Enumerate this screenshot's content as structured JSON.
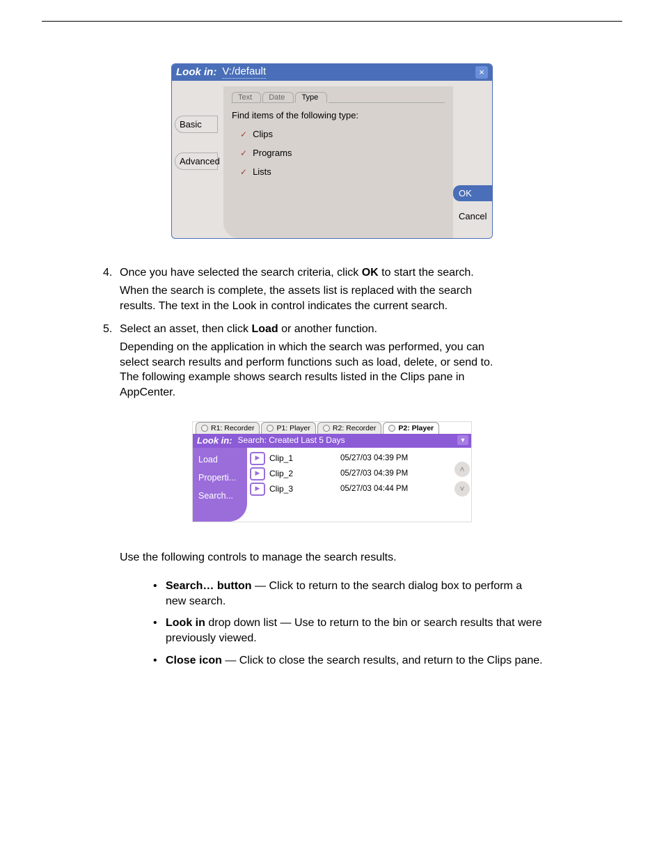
{
  "dialog1": {
    "lookin_label": "Look in:",
    "lookin_path": "V:/default",
    "left_tabs": [
      "Basic",
      "Advanced"
    ],
    "sub_tabs": [
      "Text",
      "Date",
      "Type"
    ],
    "find_label": "Find items of the following type:",
    "checks": [
      "Clips",
      "Programs",
      "Lists"
    ],
    "ok": "OK",
    "cancel": "Cancel"
  },
  "steps": {
    "s4_num": "4.",
    "s4_text": "Once you have selected the search criteria, click ",
    "s4_btn": "OK",
    "s4_tail": " to start the search.",
    "s4_sub": "When the search is complete, the assets list is replaced with the search results. The text in the Look in control indicates the current search.",
    "s5_num": "5.",
    "s5_text": "Select an asset, then click ",
    "s5_btn": "Load",
    "s5_tail": " or another function.",
    "s5_sub": "Depending on the application in which the search was performed, you can select search results and perform functions such as load, delete, or send to. The following example shows search results listed in the Clips pane in AppCenter.",
    "use_label": "Use the following controls to manage the search results.",
    "bullets": [
      {
        "bold": "Search… button",
        "text": " — Click to return to the search dialog box to perform a new search."
      },
      {
        "bold": "Look in",
        "text": " drop down list — Use to return to the bin or search results that were previously viewed."
      },
      {
        "bold": "Close icon ",
        "text": "— Click to close the search results, and return to the Clips pane."
      }
    ]
  },
  "dialog2": {
    "tabs": [
      "R1: Recorder",
      "P1: Player",
      "R2: Recorder",
      "P2: Player"
    ],
    "lookin_label": "Look in:",
    "lookin_value": "Search: Created Last 5 Days",
    "side_items": [
      "Load",
      "Properti...",
      "Search..."
    ],
    "clips": [
      {
        "name": "Clip_1",
        "date": "05/27/03 04:39 PM"
      },
      {
        "name": "Clip_2",
        "date": "05/27/03 04:39 PM"
      },
      {
        "name": "Clip_3",
        "date": "05/27/03 04:44 PM"
      }
    ]
  }
}
